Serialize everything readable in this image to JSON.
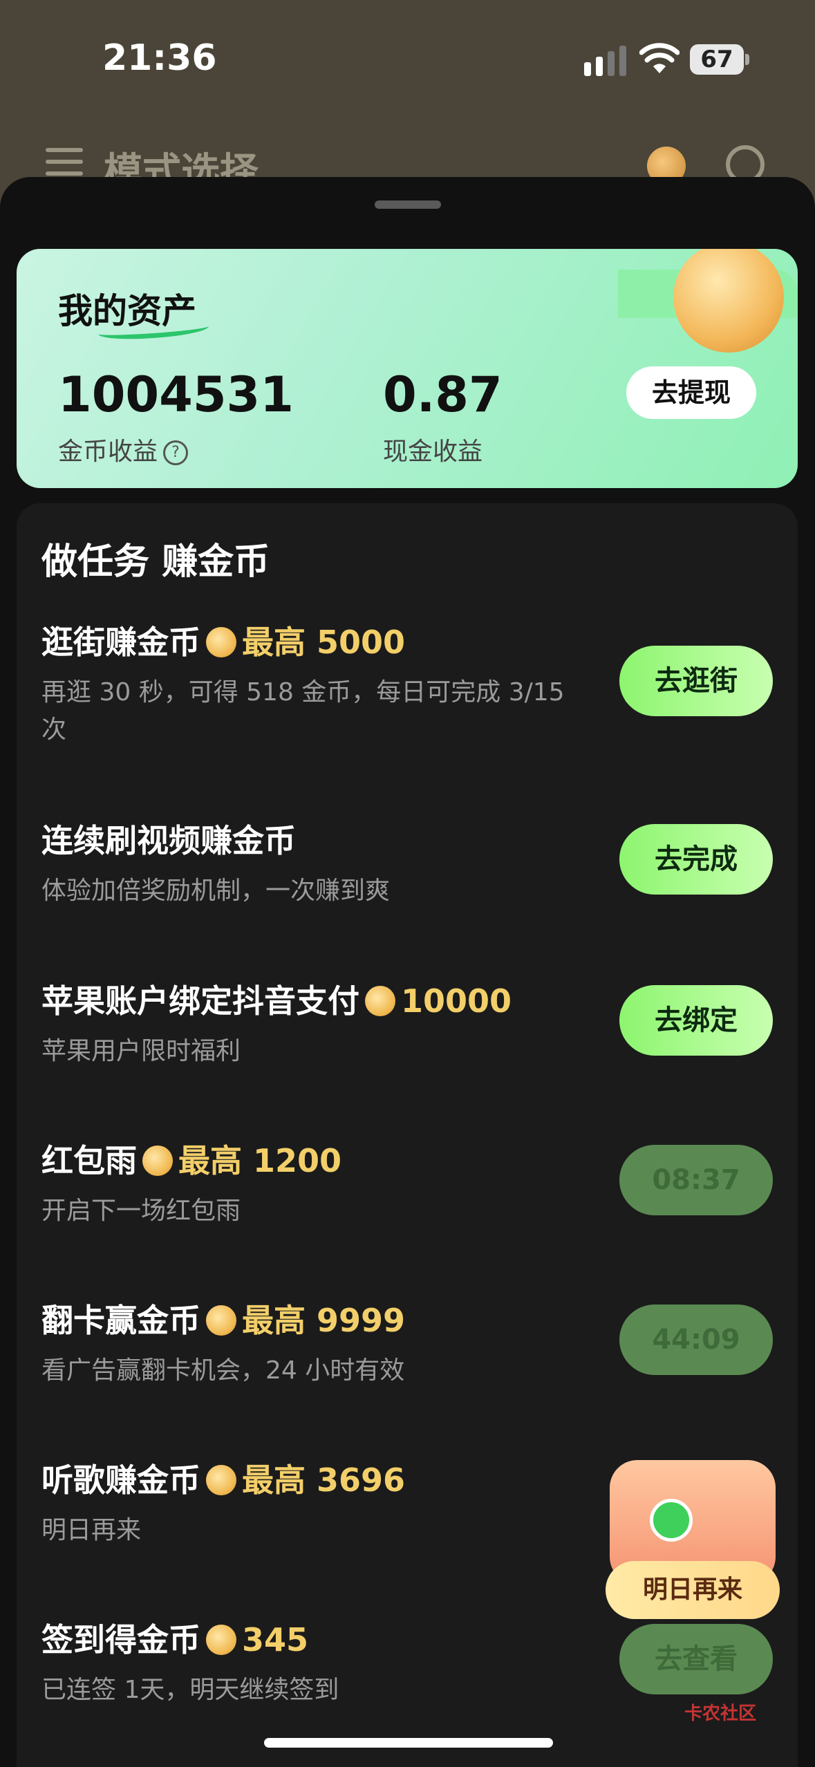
{
  "status_bar": {
    "time": "21:36",
    "battery": "67"
  },
  "header": {
    "title": "模式选择"
  },
  "asset_card": {
    "title": "我的资产",
    "gold_value": "1004531",
    "gold_label": "金币收益",
    "cash_value": "0.87",
    "cash_label": "现金收益",
    "withdraw_label": "去提现"
  },
  "tasks_title": "做任务 赚金币",
  "tasks": [
    {
      "title": "逛街赚金币",
      "reward": "最高 5000",
      "desc": "再逛 30 秒，可得 518 金币，每日可完成 3/15 次",
      "button": "去逛街",
      "state": "active"
    },
    {
      "title": "连续刷视频赚金币",
      "reward": "",
      "desc": "体验加倍奖励机制，一次赚到爽",
      "button": "去完成",
      "state": "active"
    },
    {
      "title": "苹果账户绑定抖音支付",
      "reward": "10000",
      "desc": "苹果用户限时福利",
      "button": "去绑定",
      "state": "active"
    },
    {
      "title": "红包雨",
      "reward": "最高 1200",
      "desc": "开启下一场红包雨",
      "button": "08:37",
      "state": "disabled"
    },
    {
      "title": "翻卡赢金币",
      "reward": "最高 9999",
      "desc": "看广告赢翻卡机会，24 小时有效",
      "button": "44:09",
      "state": "disabled"
    },
    {
      "title": "听歌赚金币",
      "reward": "最高 3696",
      "desc": "明日再来",
      "button": "",
      "state": "hidden"
    },
    {
      "title": "签到得金币",
      "reward": "345",
      "desc": "已连签 1天，明天继续签到",
      "button": "去查看",
      "state": "disabled"
    }
  ],
  "chest": {
    "label": "明日再来"
  },
  "watermark": "卡农社区",
  "colors": {
    "accent_green": "#8df56f",
    "reward_gold": "#f3cf6a",
    "sheet_bg": "#111111"
  }
}
